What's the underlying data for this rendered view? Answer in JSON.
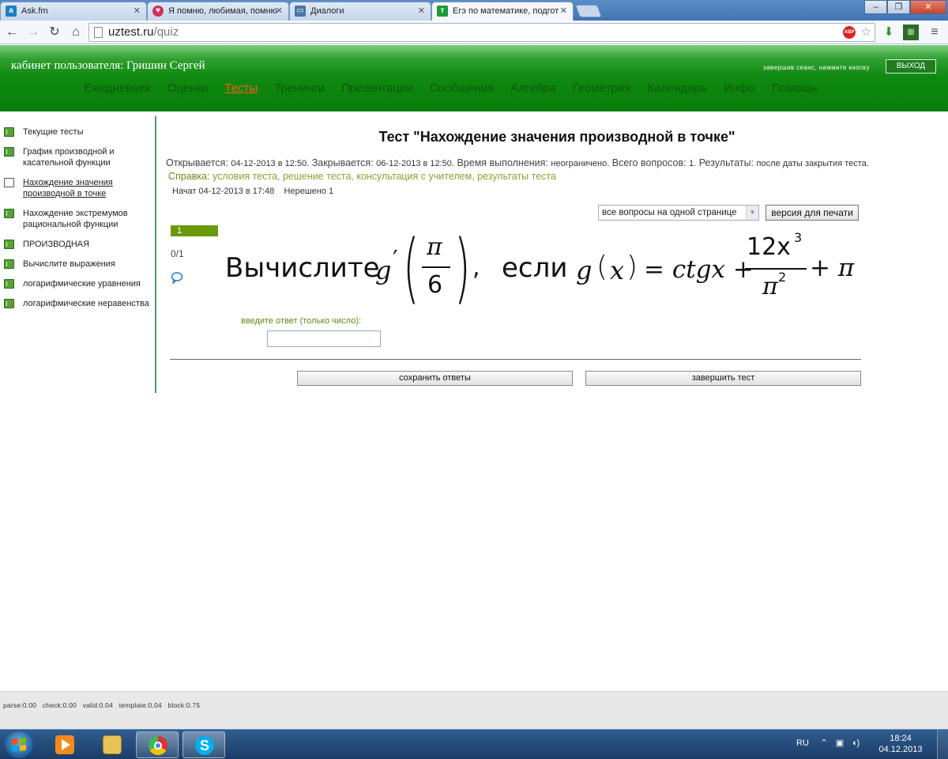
{
  "browser": {
    "tabs": [
      {
        "title": "Ask.fm",
        "icon": "ask-fm-icon",
        "color": "#1d7dc4"
      },
      {
        "title": "Я помню, любимая, помню",
        "icon": "heart-icon",
        "color": "#d0305a"
      },
      {
        "title": "Диалоги",
        "icon": "vk-icon",
        "color": "#4a76a8"
      },
      {
        "title": "Егэ по математике, подгот",
        "icon": "uztest-icon",
        "color": "#1a9a3a"
      }
    ],
    "url_host": "uztest.ru",
    "url_path": "/quiz",
    "window_buttons": {
      "minimize": "‒",
      "maximize": "❐",
      "close": "✕"
    }
  },
  "header": {
    "cabinet": "кабинет пользователя: Гришин Сергей",
    "logout_hint": "завершив сеанс, нажмите кнопку",
    "logout_button": "ВЫХОД",
    "nav": [
      {
        "label": "Ежедневник"
      },
      {
        "label": "Оценки"
      },
      {
        "label": "Тесты",
        "active": true
      },
      {
        "label": "Тренинги"
      },
      {
        "label": "Презентации"
      },
      {
        "label": "Сообщения"
      },
      {
        "label": "Алгебра"
      },
      {
        "label": "Геометрия"
      },
      {
        "label": "Календарь"
      },
      {
        "label": "Инфо"
      },
      {
        "label": "Помощь"
      }
    ]
  },
  "sidebar": {
    "items": [
      {
        "label": "Текущие тесты"
      },
      {
        "label": "График производной и касательной функции"
      },
      {
        "label": "Нахождение значения производной в точке",
        "current": true
      },
      {
        "label": "Нахождение экстремумов рациональной функции"
      },
      {
        "label": "ПРОИЗВОДНАЯ"
      },
      {
        "label": "Вычислите выражения"
      },
      {
        "label": "логарифмические уравнения"
      },
      {
        "label": "логарифмические неравенства"
      }
    ]
  },
  "test": {
    "title": "Тест \"Нахождение значения производной в точке\"",
    "opens_label": "Открывается:",
    "opens_value": "04-12-2013 в 12:50.",
    "closes_label": "Закрывается:",
    "closes_value": "06-12-2013 в 12:50.",
    "duration_label": "Время выполнения:",
    "duration_value": "неограничено.",
    "questions_label": "Всего вопросов:",
    "questions_value": "1.",
    "results_label": "Результаты:",
    "results_value": "после даты закрытия теста.",
    "help_label": "Справка:",
    "help_links": "условия теста, решение теста, консультация с учителем, результаты теста",
    "started": "Начат 04-12-2013 в 17:48",
    "unsolved": "Нерешено 1",
    "view_mode": "все вопросы на одной странице",
    "print_button": "версия для печати"
  },
  "question": {
    "number": "1",
    "score": "0/1",
    "formula": {
      "prefix": "Вычислите",
      "func": "g",
      "prime": "′",
      "num": "π",
      "den": "6",
      "comma": ",",
      "if_word": "если",
      "gx": "g",
      "x": "x",
      "eq": "= ctgx +",
      "coef": "12x",
      "exp3": "3",
      "pi2": "π",
      "exp2": "2",
      "tail": "+ π"
    },
    "answer_label": "введите ответ (только число):",
    "answer_value": ""
  },
  "actions": {
    "save": "сохранить ответы",
    "finish": "завершить тест"
  },
  "debug": "parse:0.00   check:0.00   valid:0.04   template:0.04   block:0.75",
  "taskbar": {
    "lang": "RU",
    "time": "18:24",
    "date": "04.12.2013"
  }
}
